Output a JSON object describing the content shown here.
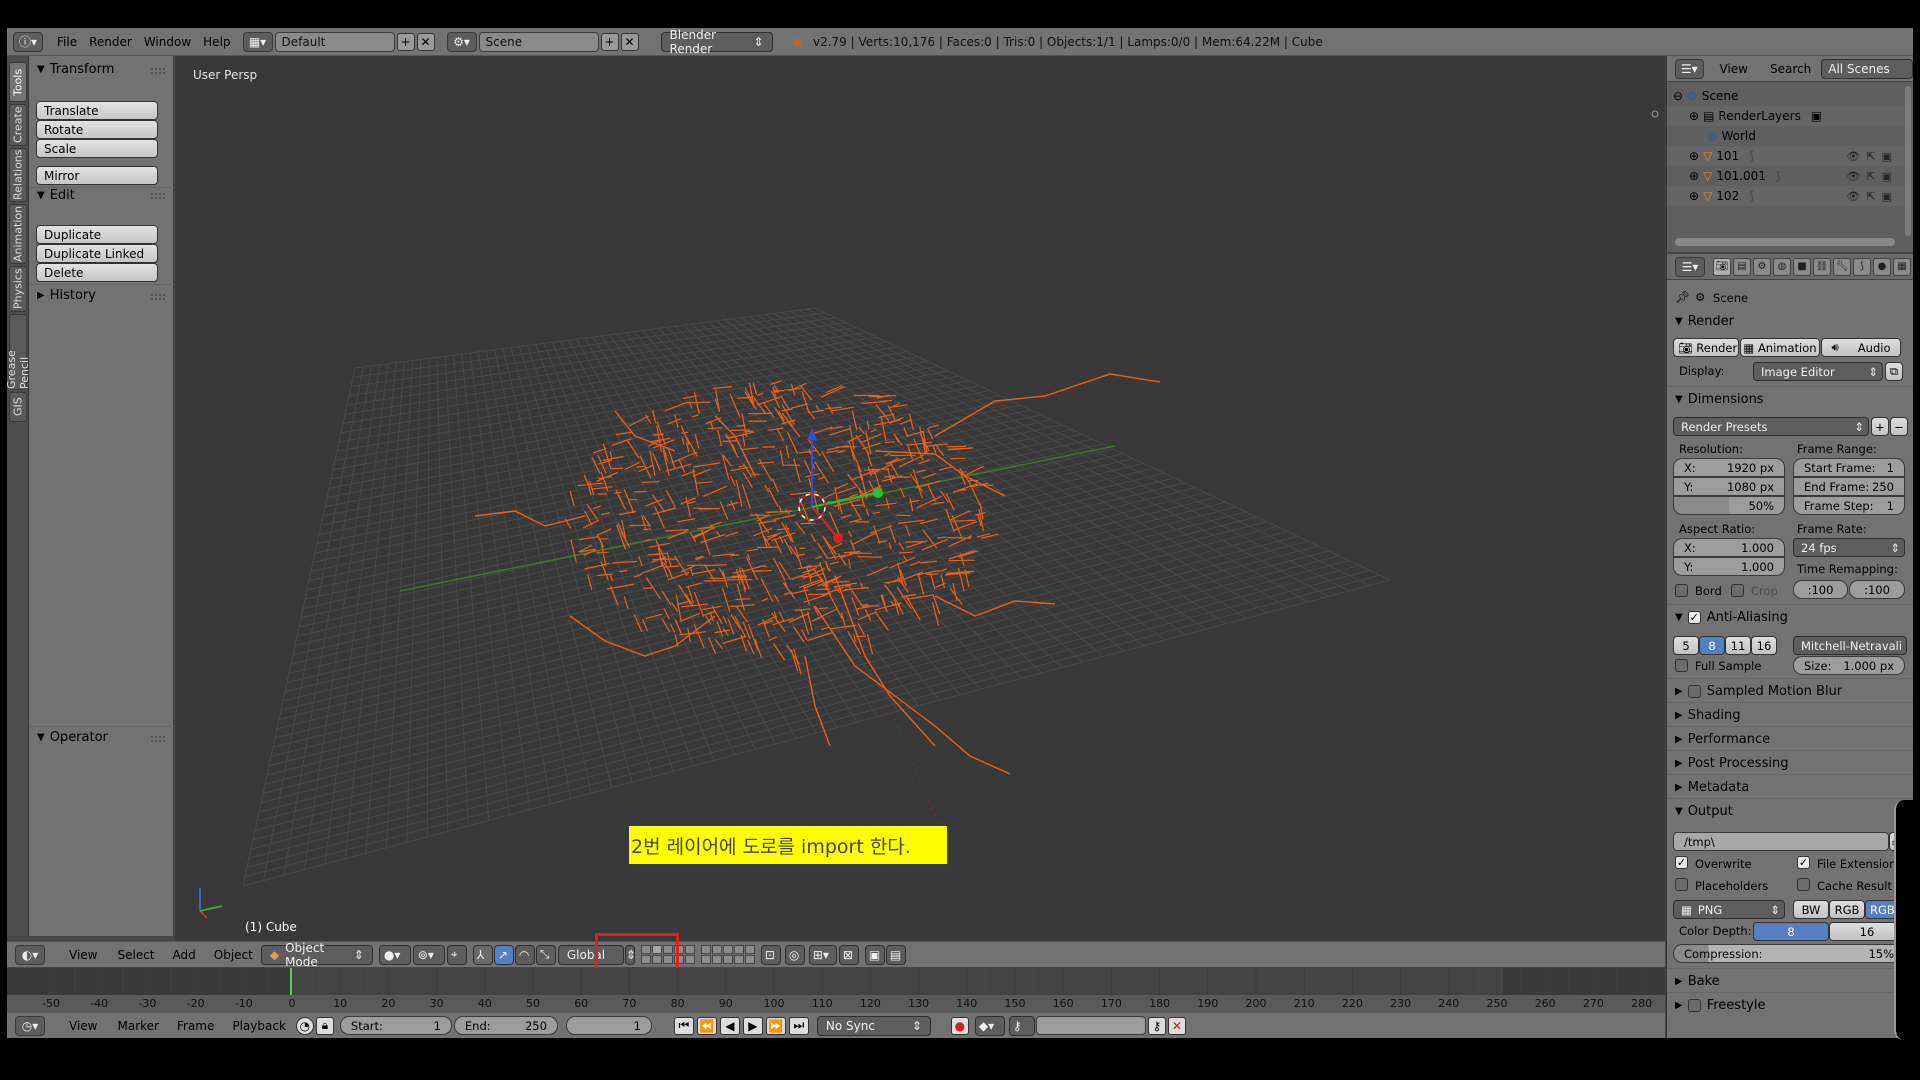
{
  "topbar": {
    "menus": [
      "File",
      "Render",
      "Window",
      "Help"
    ],
    "layout": "Default",
    "scene": "Scene",
    "engine": "Blender Render",
    "stats": "v2.79 | Verts:10,176 | Faces:0 | Tris:0 | Objects:1/1 | Lamps:0/0 | Mem:64.22M | Cube"
  },
  "vtabs": [
    "Tools",
    "Create",
    "Relations",
    "Animation",
    "Physics",
    "Grease Pencil",
    "GIS"
  ],
  "toolshelf": {
    "transform_title": "Transform",
    "translate": "Translate",
    "rotate": "Rotate",
    "scale": "Scale",
    "mirror": "Mirror",
    "edit_title": "Edit",
    "duplicate": "Duplicate",
    "duplicate_linked": "Duplicate Linked",
    "delete": "Delete",
    "history_title": "History",
    "operator_title": "Operator"
  },
  "viewport": {
    "label": "User Persp",
    "object_label": "(1) Cube",
    "note": "2번 레이어에 도로를 import 한다."
  },
  "vp_header": {
    "menus": [
      "View",
      "Select",
      "Add",
      "Object"
    ],
    "mode": "Object Mode",
    "orientation": "Global"
  },
  "timeline": {
    "ticks": [
      "-50",
      "-40",
      "-30",
      "-20",
      "-10",
      "0",
      "10",
      "20",
      "30",
      "40",
      "50",
      "60",
      "70",
      "80",
      "90",
      "100",
      "110",
      "120",
      "130",
      "140",
      "150",
      "160",
      "170",
      "180",
      "190",
      "200",
      "210",
      "220",
      "230",
      "240",
      "250",
      "260",
      "270",
      "280"
    ],
    "menus": [
      "View",
      "Marker",
      "Frame",
      "Playback"
    ],
    "start_label": "Start:",
    "start_value": "1",
    "end_label": "End:",
    "end_value": "250",
    "current": "1",
    "sync": "No Sync"
  },
  "outliner": {
    "view": "View",
    "search": "Search",
    "filter": "All Scenes",
    "items": [
      "Scene",
      "RenderLayers",
      "World",
      "101",
      "101.001",
      "102"
    ]
  },
  "props": {
    "breadcrumb": "Scene",
    "render_title": "Render",
    "render_btn": "Render",
    "animation_btn": "Animation",
    "audio_btn": "Audio",
    "display_label": "Display:",
    "display_value": "Image Editor",
    "dimensions_title": "Dimensions",
    "render_presets": "Render Presets",
    "resolution_label": "Resolution:",
    "res_x_label": "X:",
    "res_x": "1920 px",
    "res_y_label": "Y:",
    "res_y": "1080 px",
    "res_pct": "50%",
    "frame_range_label": "Frame Range:",
    "start_frame_label": "Start Frame:",
    "start_frame": "1",
    "end_frame_label": "End Frame:",
    "end_frame": "250",
    "frame_step_label": "Frame Step:",
    "frame_step": "1",
    "aspect_label": "Aspect Ratio:",
    "asp_x": "1.000",
    "asp_y": "1.000",
    "frame_rate_label": "Frame Rate:",
    "frame_rate": "24 fps",
    "bord": "Bord",
    "crop": "Crop",
    "time_remap_label": "Time Remapping:",
    "remap_old": ":100",
    "remap_new": ":100",
    "aa_title": "Anti-Aliasing",
    "aa_samples": [
      "5",
      "8",
      "11",
      "16"
    ],
    "aa_filter": "Mitchell-Netravali",
    "full_sample": "Full Sample",
    "size_label": "Size:",
    "size_value": "1.000 px",
    "motion_blur": "Sampled Motion Blur",
    "shading": "Shading",
    "performance": "Performance",
    "post_processing": "Post Processing",
    "metadata": "Metadata",
    "output_title": "Output",
    "output_path": "/tmp\\",
    "overwrite": "Overwrite",
    "file_extensions": "File Extensions",
    "placeholders": "Placeholders",
    "cache_result": "Cache Result",
    "format": "PNG",
    "bw": "BW",
    "rgb": "RGB",
    "rgba": "RGBA",
    "color_depth_label": "Color Depth:",
    "depth_8": "8",
    "depth_16": "16",
    "compression_label": "Compression:",
    "compression_value": "15%",
    "bake": "Bake",
    "freestyle": "Freestyle"
  },
  "colors": {
    "roads": "#e8601c",
    "grid": "#4a4a4a",
    "note_bg": "#ffff00",
    "highlight": "#e02020",
    "selected": "#5680c2"
  }
}
